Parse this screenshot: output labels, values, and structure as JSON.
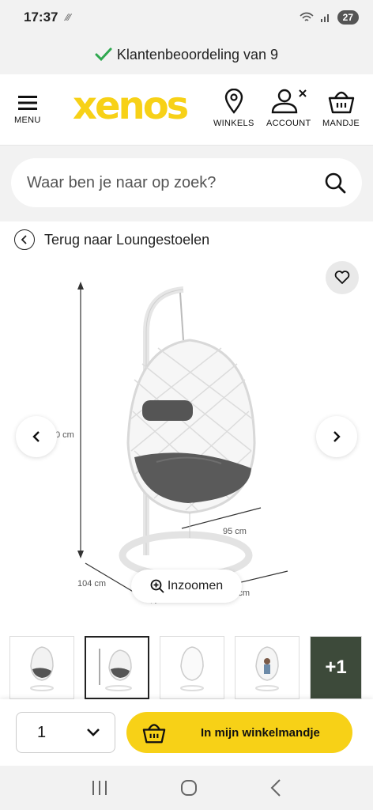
{
  "status_bar": {
    "time": "17:37",
    "battery": "27"
  },
  "review_bar": {
    "text": "Klantenbeoordeling van 9"
  },
  "header": {
    "logo": "xenos",
    "menu_label": "MENU",
    "stores_label": "WINKELS",
    "account_label": "ACCOUNT",
    "cart_label": "MANDJE"
  },
  "search": {
    "placeholder": "Waar ben je naar op zoek?"
  },
  "breadcrumb": {
    "back_label": "Terug naar Loungestoelen"
  },
  "gallery": {
    "zoom_label": "Inzoomen",
    "dimensions": {
      "height": "0 cm",
      "depth": "95 cm",
      "width_left": "104 cm",
      "width_right": "104 cm"
    },
    "thumbnail_more": "+1"
  },
  "actions": {
    "quantity": "1",
    "add_to_cart_label": "In mijn winkelmandje"
  },
  "colors": {
    "brand": "#f7d117",
    "check": "#2fa84f"
  }
}
